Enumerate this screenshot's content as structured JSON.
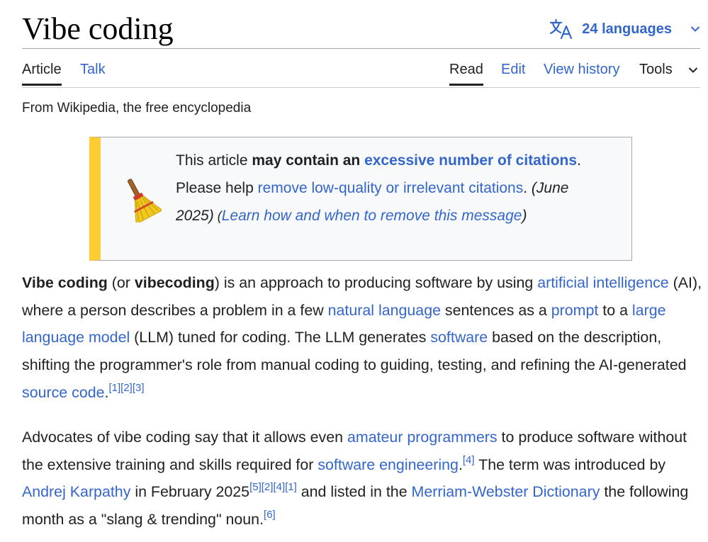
{
  "header": {
    "title": "Vibe coding",
    "languages_label": "24 languages"
  },
  "tabs": {
    "article": "Article",
    "talk": "Talk",
    "read": "Read",
    "edit": "Edit",
    "view_history": "View history",
    "tools": "Tools"
  },
  "tagline": "From Wikipedia, the free encyclopedia",
  "notice": {
    "t1": "This article ",
    "t2": "may contain an ",
    "t3": "excessive number of citations",
    "t4": ". Please help ",
    "t5": "remove low-quality or irrelevant citations",
    "t6": ". ",
    "t7": "(June 2025)",
    "t8": " (",
    "t9": "Learn how and when to remove this message",
    "t10": ")"
  },
  "paragraph1": {
    "s1": "Vibe coding",
    "s2": " (or ",
    "s3": "vibecoding",
    "s4": ") is an approach to producing software by using ",
    "l1": "artificial intelligence",
    "s5": " (AI), where a person describes a problem in a few ",
    "l2": "natural language",
    "s6": " sentences as a ",
    "l3": "prompt",
    "s7": " to a ",
    "l4": "large language model",
    "s8": " (LLM) tuned for coding. The LLM generates ",
    "l5": "software",
    "s9": " based on the description, shifting the programmer's role from manual coding to guiding, testing, and refining the AI-generated ",
    "l6": "source code",
    "s10": ".",
    "c1": "[1]",
    "c2": "[2]",
    "c3": "[3]"
  },
  "paragraph2": {
    "s1": "Advocates of vibe coding say that it allows even ",
    "l1": "amateur programmers",
    "s2": " to produce software without the extensive training and skills required for ",
    "l2": "software engineering",
    "s3": ".",
    "c1": "[4]",
    "s4": " The term was introduced by ",
    "l3": "Andrej Karpathy",
    "s5": " in February 2025",
    "c2": "[5]",
    "c3": "[2]",
    "c4": "[4]",
    "c5": "[1]",
    "s6": " and listed in the ",
    "l4": "Merriam-Webster Dictionary",
    "s7": " the following month as a \"slang & trending\" noun.",
    "c6": "[6]"
  },
  "icons": {
    "languages": "translate-icon",
    "chevron": "chevron-down-icon",
    "cleanup": "broom-icon"
  },
  "colors": {
    "link": "#3366cc",
    "notice_stripe": "#ffcc33",
    "text": "#202122"
  }
}
